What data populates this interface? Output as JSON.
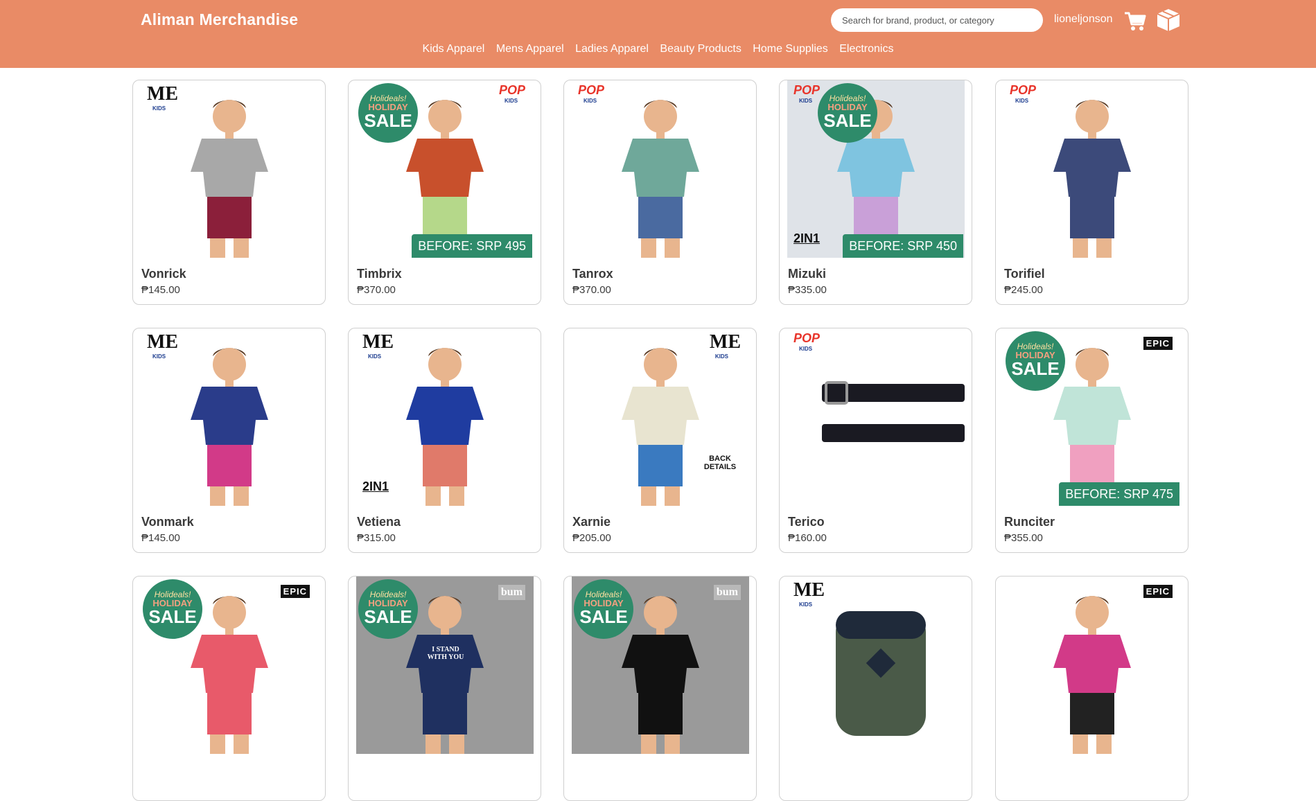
{
  "header": {
    "brand": "Aliman Merchandise",
    "search_placeholder": "Search for brand, product, or category",
    "username": "lioneljonson",
    "cart_icon": "cart-icon",
    "orders_icon": "box-icon",
    "colors": {
      "header_bg": "#e98b66",
      "sale_badge": "#2e8b6a"
    }
  },
  "nav": [
    "Kids Apparel",
    "Mens Apparel",
    "Ladies Apparel",
    "Beauty Products",
    "Home Supplies",
    "Electronics"
  ],
  "products": [
    {
      "name": "Vonrick",
      "price": "₱145.00",
      "brand_tag": "ME KIDS 4-8 Y.O."
    },
    {
      "name": "Timbrix",
      "price": "₱370.00",
      "brand_tag": "POP KIDS 4-8 Y.O.",
      "sale_badge": {
        "line1": "Holideals!",
        "line2": "HOLIDAY",
        "line3": "SALE"
      },
      "before": "BEFORE: SRP 495"
    },
    {
      "name": "Tanrox",
      "price": "₱370.00",
      "brand_tag": "POP KIDS 4-8 Y.O."
    },
    {
      "name": "Mizuki",
      "price": "₱335.00",
      "brand_tag": "POP KIDS 4-8 Y.O.",
      "sale_badge": {
        "line1": "Holideals!",
        "line2": "HOLIDAY",
        "line3": "SALE"
      },
      "before": "BEFORE: SRP 450",
      "extra": "2IN1"
    },
    {
      "name": "Torifiel",
      "price": "₱245.00",
      "brand_tag": "POP KIDS 4-8 Y.O."
    },
    {
      "name": "Vonmark",
      "price": "₱145.00",
      "brand_tag": "ME KIDS 4-8 Y.O."
    },
    {
      "name": "Vetiena",
      "price": "₱315.00",
      "brand_tag": "ME KIDS 4-8 Y.O.",
      "extra": "2IN1"
    },
    {
      "name": "Xarnie",
      "price": "₱205.00",
      "brand_tag": "ME KIDS 4-8 Y.O.",
      "extra": "BACK DETAILS"
    },
    {
      "name": "Terico",
      "price": "₱160.00",
      "brand_tag": "POP KIDS 4-8 Y.O."
    },
    {
      "name": "Runciter",
      "price": "₱355.00",
      "brand_tag": "EPIC",
      "sale_badge": {
        "line1": "Holideals!",
        "line2": "HOLIDAY",
        "line3": "SALE"
      },
      "before": "BEFORE: SRP 475"
    },
    {
      "name": "",
      "price": "",
      "brand_tag": "EPIC",
      "sale_badge": {
        "line1": "Holideals!",
        "line2": "HOLIDAY",
        "line3": "SALE"
      }
    },
    {
      "name": "",
      "price": "",
      "brand_tag": "bum",
      "sale_badge": {
        "line1": "Holideals!",
        "line2": "HOLIDAY",
        "line3": "SALE"
      },
      "shirt_text": "I STAND WITH YOU"
    },
    {
      "name": "",
      "price": "",
      "brand_tag": "bum",
      "sale_badge": {
        "line1": "Holideals!",
        "line2": "HOLIDAY",
        "line3": "SALE"
      }
    },
    {
      "name": "",
      "price": "",
      "brand_tag": "ME"
    },
    {
      "name": "",
      "price": "",
      "brand_tag": "EPIC"
    }
  ]
}
